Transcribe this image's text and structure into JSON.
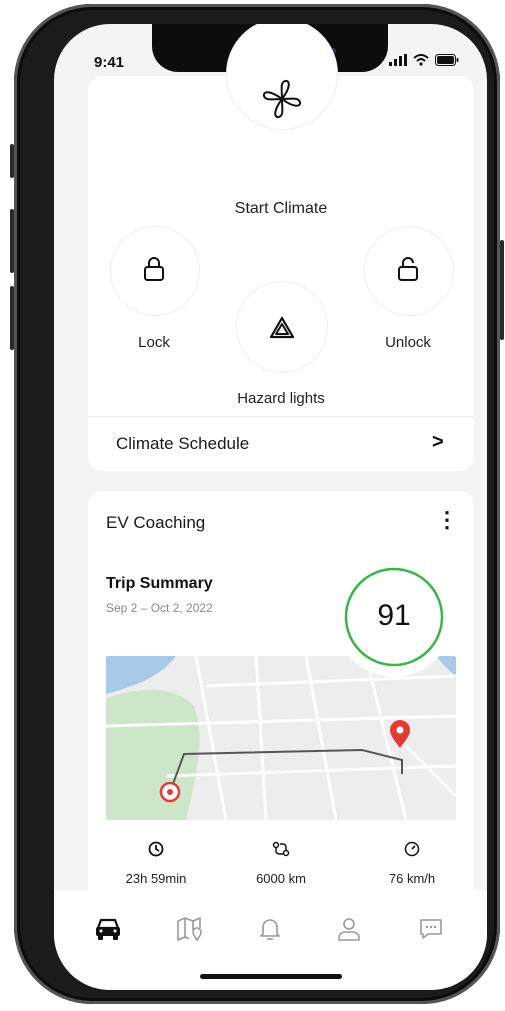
{
  "status": {
    "time": "9:41"
  },
  "controls": {
    "start_climate": "Start Climate",
    "lock": "Lock",
    "unlock": "Unlock",
    "hazard": "Hazard lights",
    "climate_schedule": "Climate Schedule",
    "chevron": ">"
  },
  "ev": {
    "title": "EV Coaching",
    "menu": "⋮",
    "trip_title": "Trip Summary",
    "trip_dates": "Sep 2 – Oct 2, 2022",
    "score": 91,
    "score_color": "#3bb54a",
    "stats": [
      {
        "value": "23h 59min",
        "icon": "clock-icon"
      },
      {
        "value": "6000 km",
        "icon": "route-icon"
      },
      {
        "value": "76 km/h",
        "icon": "speedometer-icon"
      }
    ]
  },
  "colors": {
    "accent_red": "#e53935",
    "map_water": "#a9c9e8",
    "map_park": "#cde6c9"
  },
  "tabs": [
    {
      "icon": "car-icon",
      "active": true
    },
    {
      "icon": "map-icon",
      "active": false
    },
    {
      "icon": "bell-icon",
      "active": false
    },
    {
      "icon": "profile-icon",
      "active": false
    },
    {
      "icon": "chat-icon",
      "active": false
    }
  ]
}
